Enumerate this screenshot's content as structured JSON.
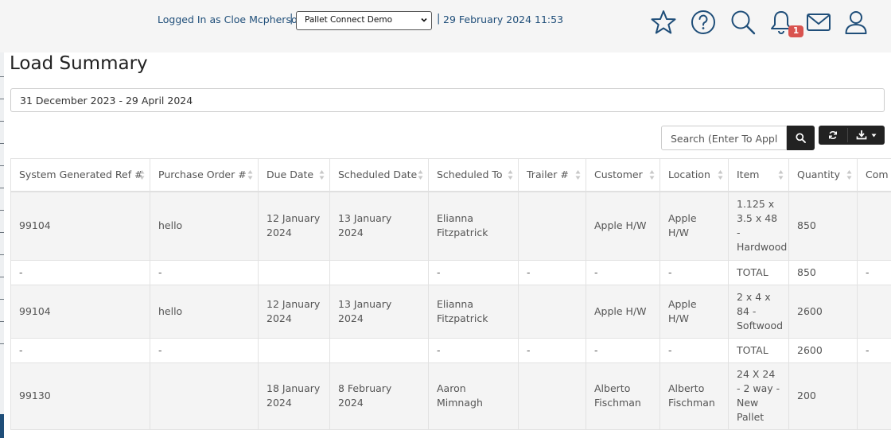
{
  "header": {
    "session_label": "Logged In as Cloe Mcpherson",
    "separator": "|",
    "site_selected": "Pallet Connect Demo",
    "datetime": "29 February 2024 11:53",
    "notification_count": "1",
    "icons": [
      "star-icon",
      "help-icon",
      "search-icon",
      "bell-icon",
      "mail-icon",
      "user-icon"
    ]
  },
  "page": {
    "title": "Load Summary",
    "date_range": "31 December 2023 - 29 April 2024"
  },
  "toolbar": {
    "search_placeholder": "Search (Enter To Appl",
    "icons": [
      "search-icon",
      "refresh-icon",
      "download-icon",
      "caret-down-icon"
    ]
  },
  "table": {
    "columns": [
      "System Generated Ref #",
      "Purchase Order #",
      "Due Date",
      "Scheduled Date",
      "Scheduled To",
      "Trailer #",
      "Customer",
      "Location",
      "Item",
      "Quantity",
      "Com"
    ],
    "rows": [
      [
        "99104",
        "hello",
        "12 January 2024",
        "13 January 2024",
        "Elianna Fitzpatrick",
        "",
        "Apple H/W",
        "Apple H/W",
        "1.125 x 3.5 x 48 - Hardwood",
        "850",
        ""
      ],
      [
        "-",
        "-",
        "",
        "",
        "-",
        "-",
        "-",
        "-",
        "TOTAL",
        "850",
        "-"
      ],
      [
        "99104",
        "hello",
        "12 January 2024",
        "13 January 2024",
        "Elianna Fitzpatrick",
        "",
        "Apple H/W",
        "Apple H/W",
        "2 x 4 x 84 - Softwood",
        "2600",
        ""
      ],
      [
        "-",
        "-",
        "",
        "",
        "-",
        "-",
        "-",
        "-",
        "TOTAL",
        "2600",
        "-"
      ],
      [
        "99130",
        "",
        "18 January 2024",
        "8 February 2024",
        "Aaron Mimnagh",
        "",
        "Alberto Fischman",
        "Alberto Fischman",
        "24 X 24 - 2 way - New Pallet",
        "200",
        ""
      ]
    ]
  },
  "colors": {
    "brand": "#1f4e79",
    "badge": "#d9534f",
    "button_dark": "#222222"
  }
}
